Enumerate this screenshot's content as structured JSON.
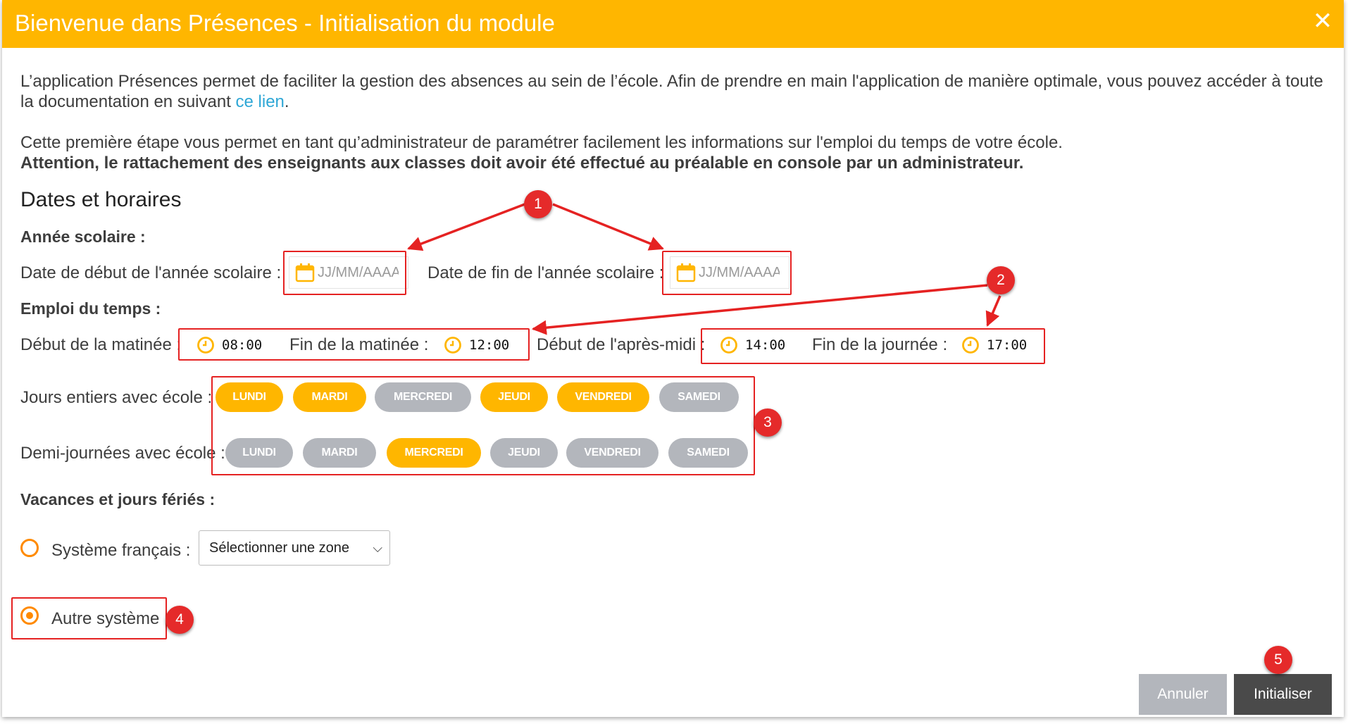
{
  "dialog": {
    "title": "Bienvenue dans Présences - Initialisation du module",
    "close_label": "✕"
  },
  "intro": {
    "line1": "L’application Présences permet de faciliter la gestion des absences au sein de l’école. Afin de prendre en main l'application de manière optimale, vous pouvez accéder à toute",
    "line2_prefix": "la documentation en suivant ",
    "link_text": "ce lien",
    "line2_suffix": ".",
    "line3": "Cette première étape vous permet en tant qu’administrateur de paramétrer facilement les informations sur l'emploi du temps de votre école.",
    "warning": "Attention, le rattachement des enseignants aux classes doit avoir été effectué au préalable en console par un administrateur."
  },
  "section_title": "Dates et horaires",
  "school_year": {
    "title": "Année scolaire :",
    "start_label": "Date de début de l'année scolaire :",
    "start_placeholder": "JJ/MM/AAAA",
    "end_label": "Date de fin de l'année scolaire :",
    "end_placeholder": "JJ/MM/AAAA"
  },
  "schedule": {
    "title": "Emploi du temps :",
    "morning_start_label": "Début de la matinée :",
    "morning_start": "08:00",
    "morning_end_label": "Fin de la matinée :",
    "morning_end": "12:00",
    "afternoon_start_label": "Début de l'après-midi :",
    "afternoon_start": "14:00",
    "day_end_label": "Fin de la journée :",
    "day_end": "17:00"
  },
  "full_days": {
    "label": "Jours entiers avec école :",
    "days": [
      {
        "label": "LUNDI",
        "selected": true
      },
      {
        "label": "MARDI",
        "selected": true
      },
      {
        "label": "MERCREDI",
        "selected": false
      },
      {
        "label": "JEUDI",
        "selected": true
      },
      {
        "label": "VENDREDI",
        "selected": true
      },
      {
        "label": "SAMEDI",
        "selected": false
      }
    ]
  },
  "half_days": {
    "label": "Demi-journées avec école :",
    "days": [
      {
        "label": "LUNDI",
        "selected": false
      },
      {
        "label": "MARDI",
        "selected": false
      },
      {
        "label": "MERCREDI",
        "selected": true
      },
      {
        "label": "JEUDI",
        "selected": false
      },
      {
        "label": "VENDREDI",
        "selected": false
      },
      {
        "label": "SAMEDI",
        "selected": false
      }
    ]
  },
  "holidays": {
    "title": "Vacances et jours fériés :",
    "french_system_label": "Système français :",
    "zone_select_value": "Sélectionner une zone",
    "other_system_label": "Autre système",
    "selected_option": "other"
  },
  "buttons": {
    "cancel": "Annuler",
    "initialize": "Initialiser"
  },
  "annotations": [
    "1",
    "2",
    "3",
    "4",
    "5"
  ],
  "colors": {
    "header": "#ffb600",
    "day_selected": "#ffb600",
    "day_unselected": "#b3b6bc",
    "radio": "#ff8a00",
    "annotation_red": "#e52222",
    "link": "#2ea7d6",
    "primary_button": "#4a4a4a"
  }
}
